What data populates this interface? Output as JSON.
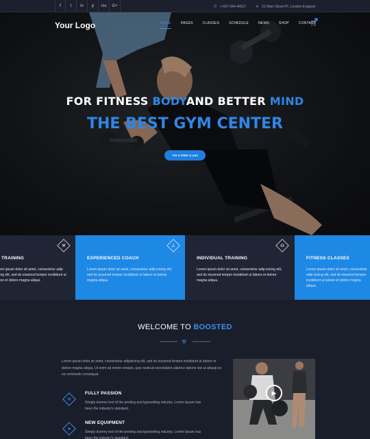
{
  "topbar": {
    "social": [
      {
        "icon": "facebook-icon",
        "glyph": "f"
      },
      {
        "icon": "twitter-icon",
        "glyph": "t"
      },
      {
        "icon": "linkedin-icon",
        "glyph": "in"
      },
      {
        "icon": "pinterest-icon",
        "glyph": "p"
      },
      {
        "icon": "rss-icon",
        "glyph": "rss"
      },
      {
        "icon": "google-plus-icon",
        "glyph": "G+"
      }
    ],
    "phone": "+-657-344-46527",
    "address": "22 Main Street Pt. London England"
  },
  "header": {
    "logo": "Your Logo",
    "nav": [
      "HOME",
      "PAGES",
      "CLASSES",
      "SCHEDULE",
      "NEWS",
      "SHOP",
      "CONTACT"
    ],
    "active_nav": "HOME",
    "cart_icon": "cart-icon"
  },
  "hero": {
    "line1_a": "FOR FITNESS ",
    "line1_b": "BODY",
    "line1_c": "AND BETTER ",
    "line1_d": "MIND",
    "line2": "THE BEST GYM CENTER",
    "cta": "TRY A FREE CLASS"
  },
  "features": [
    {
      "title": "TRAINING",
      "text": "Lorem ipsum dolor sit amet, consectetur adip isicing elit, sed do eiusmod tempor incididunt ut labore et dolore magna aliqua.",
      "icon": "dumbbell-icon",
      "style": "dark"
    },
    {
      "title": "EXPERIENCED COACH",
      "text": "Lorem ipsum dolor sit amet, consectetur adip isicing elit, sed do eiusmod tempor incididunt ut labore et dolore magna aliqua.",
      "icon": "user-icon",
      "style": "blue"
    },
    {
      "title": "INDIVIDUAL TRAINING",
      "text": "Lorem ipsum dolor sit amet, consectetur adip isicing elit, sed do eiusmod tempor incididunt ut labore et dolore magna aliqua.",
      "icon": "headphones-icon",
      "style": "dark"
    },
    {
      "title": "FITNESS CLASSES",
      "text": "Lorem ipsum dolor sit amet, consectetur adip isicing elit, sed do eiusmod tempor incididunt ut labore et dolore magna aliqua.",
      "icon": "dumbbell-icon",
      "style": "blue"
    }
  ],
  "welcome": {
    "title_a": "WELCOME TO ",
    "title_b": "BOOSTED",
    "intro": "Lorem ipsum dolor sit amet, consectetur adipisicing elit, sed do eiusmod tempor incididunt ut labore et dolore magna aliqua. Ut enim ad minim veniam, quis nostrud exercitation ullamco laboris nisi ut aliquip ex ea commodo consequat.",
    "items": [
      {
        "title": "FULLY PASSION",
        "text": "Simply dummy text of the printing and typesetting industry. Lorem Ipsum has been the industry's standard.",
        "icon": "dumbbell-icon"
      },
      {
        "title": "NEW EQUIPMENT",
        "text": "Simply dummy text of the printing and typesetting industry. Lorem Ipsum has been the industry's standard.",
        "icon": "star-icon"
      }
    ]
  },
  "colors": {
    "accent": "#1e88e5",
    "dark_panel": "#202536",
    "background": "#1a1e2b"
  }
}
